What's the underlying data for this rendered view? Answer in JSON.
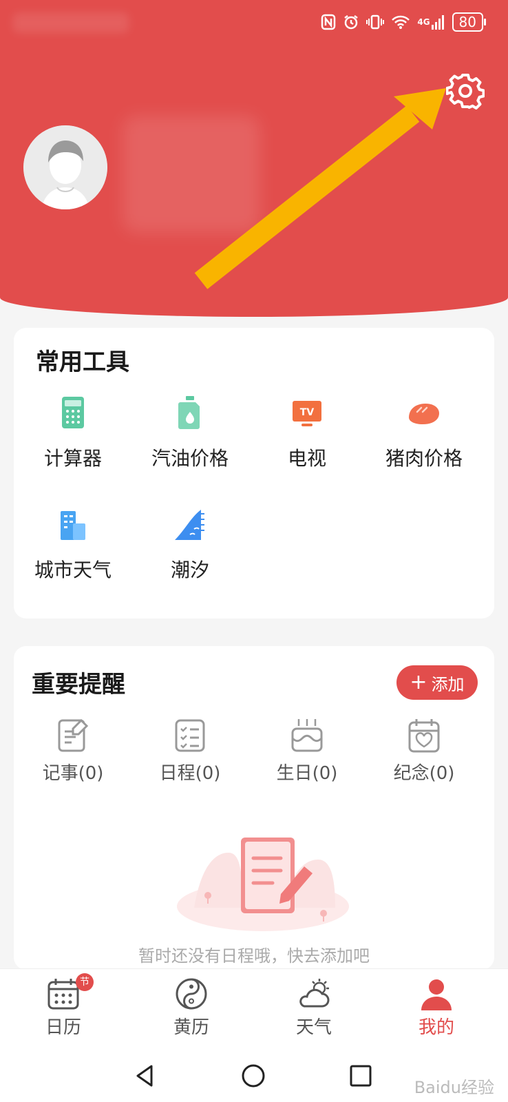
{
  "header": {
    "settings_label": "设置"
  },
  "status_bar": {
    "network": "4G",
    "battery": "80"
  },
  "tools": {
    "title": "常用工具",
    "items": [
      {
        "label": "计算器",
        "icon": "calculator-icon"
      },
      {
        "label": "汽油价格",
        "icon": "gas-can-icon"
      },
      {
        "label": "电视",
        "icon": "tv-icon"
      },
      {
        "label": "猪肉价格",
        "icon": "meat-icon"
      },
      {
        "label": "城市天气",
        "icon": "city-weather-icon"
      },
      {
        "label": "潮汐",
        "icon": "tide-icon"
      }
    ]
  },
  "reminders": {
    "title": "重要提醒",
    "add_label": "添加",
    "items": [
      {
        "label": "记事(0)",
        "icon": "note-icon"
      },
      {
        "label": "日程(0)",
        "icon": "schedule-icon"
      },
      {
        "label": "生日(0)",
        "icon": "birthday-cake-icon"
      },
      {
        "label": "纪念(0)",
        "icon": "anniversary-icon"
      }
    ],
    "empty_text": "暂时还没有日程哦，快去添加吧"
  },
  "tabbar": {
    "items": [
      {
        "label": "日历",
        "icon": "calendar-icon",
        "badge": "节"
      },
      {
        "label": "黄历",
        "icon": "yin-yang-icon"
      },
      {
        "label": "天气",
        "icon": "weather-icon"
      },
      {
        "label": "我的",
        "icon": "profile-icon",
        "active": true
      }
    ]
  },
  "watermark": "Baidu经验",
  "colors": {
    "primary": "#e24d4c",
    "arrow": "#f9b400",
    "background": "#f5f5f5"
  }
}
